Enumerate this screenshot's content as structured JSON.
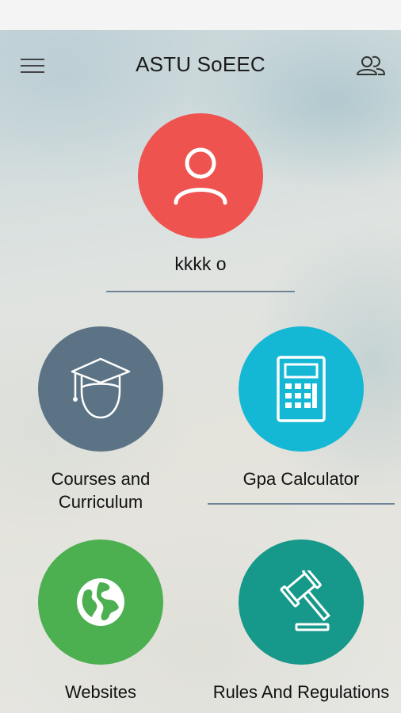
{
  "app": {
    "title": "ASTU SoEEC"
  },
  "profile": {
    "name": "kkkk o"
  },
  "tiles": [
    {
      "line1": "Courses and",
      "line2": "Curriculum",
      "color": "#5b7385",
      "icon": "graduation-cap-icon"
    },
    {
      "line1": "Gpa Calculator",
      "color": "#14b8d4",
      "icon": "calculator-icon"
    },
    {
      "line1": "Websites",
      "color": "#4caf50",
      "icon": "globe-icon"
    },
    {
      "line1": "Rules And Regulations",
      "color": "#16998a",
      "icon": "gavel-icon"
    }
  ],
  "colors": {
    "profile": "#ef5350",
    "divider": "#6f8496"
  }
}
